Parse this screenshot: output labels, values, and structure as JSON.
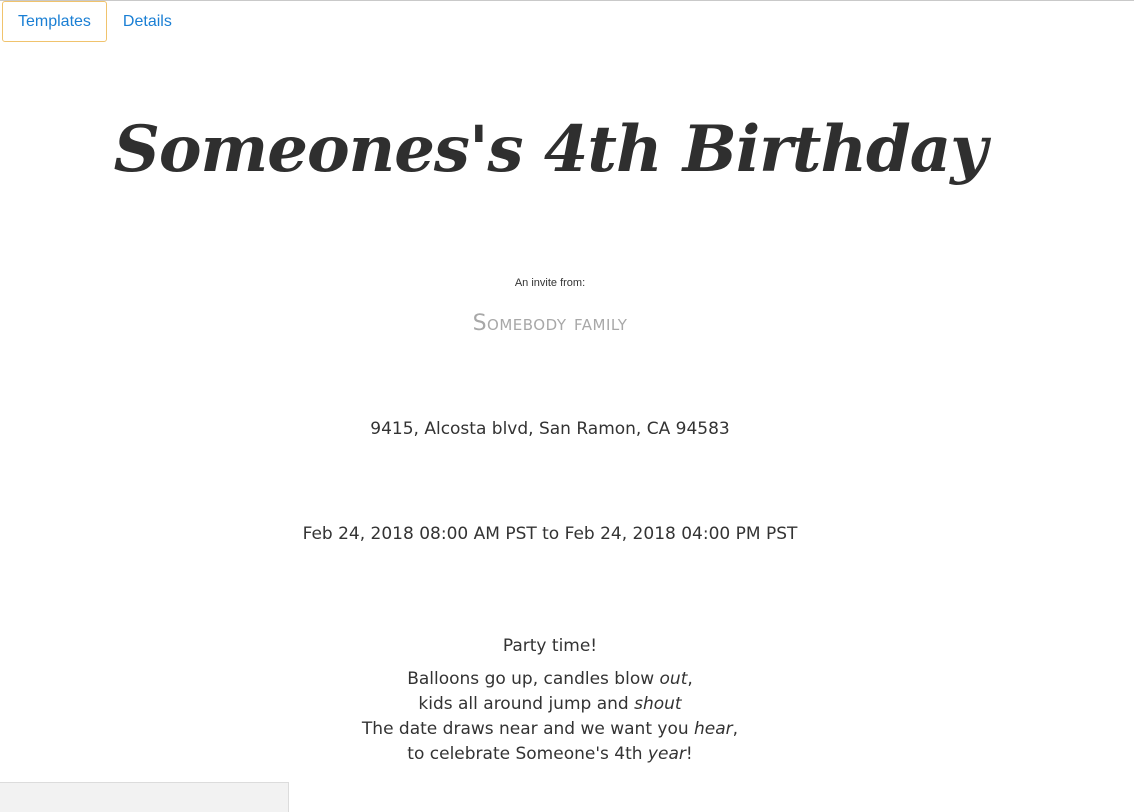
{
  "tabs": [
    {
      "label": "Templates",
      "active": true
    },
    {
      "label": "Details",
      "active": false
    }
  ],
  "invite": {
    "title": "Someones's 4th Birthday",
    "from_label": "An invite from:",
    "from_name": "Somebody family",
    "address": "9415, Alcosta blvd, San Ramon, CA 94583",
    "datetime": "Feb 24, 2018 08:00 AM PST to Feb 24, 2018 04:00 PM PST",
    "poem_title": "Party time!",
    "poem_lines": [
      {
        "text": "Balloons go up, candles blow ",
        "italic": "out",
        "end": ","
      },
      {
        "text": "kids all around jump and ",
        "italic": "shout",
        "end": ""
      },
      {
        "text": "The date draws near and we want you ",
        "italic": "hear",
        "end": ","
      },
      {
        "text": "to celebrate Someone's 4th ",
        "italic": "year",
        "end": "!"
      }
    ]
  },
  "colors": {
    "tab_link": "#1a7fd4",
    "tab_active_border": "#f0c36d",
    "text": "#333333",
    "from_name": "#a8a8a8"
  }
}
